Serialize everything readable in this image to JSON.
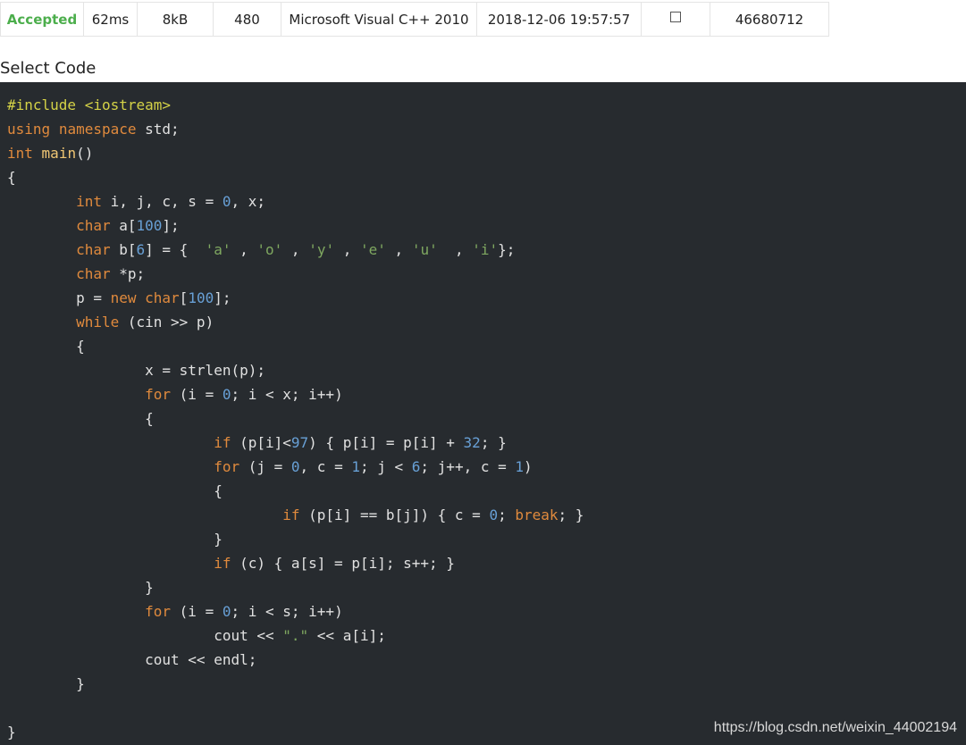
{
  "submission": {
    "verdict": "Accepted",
    "time": "62ms",
    "memory": "8kB",
    "length": "480",
    "language": "Microsoft Visual C++ 2010",
    "submit_time": "2018-12-06 19:57:57",
    "run_id": "46680712"
  },
  "code_section": {
    "label": "Select Code",
    "lines": [
      [
        {
          "t": "pre",
          "v": "#include <iostream>"
        }
      ],
      [
        {
          "t": "kw",
          "v": "using"
        },
        {
          "t": "pl",
          "v": " "
        },
        {
          "t": "kw",
          "v": "namespace"
        },
        {
          "t": "pl",
          "v": " std;"
        }
      ],
      [
        {
          "t": "kw",
          "v": "int"
        },
        {
          "t": "pl",
          "v": " "
        },
        {
          "t": "fn",
          "v": "main"
        },
        {
          "t": "pl",
          "v": "()"
        }
      ],
      [
        {
          "t": "pl",
          "v": "{"
        }
      ],
      [
        {
          "t": "pl",
          "v": "        "
        },
        {
          "t": "kw",
          "v": "int"
        },
        {
          "t": "pl",
          "v": " i, j, c, s = "
        },
        {
          "t": "num",
          "v": "0"
        },
        {
          "t": "pl",
          "v": ", x;"
        }
      ],
      [
        {
          "t": "pl",
          "v": "        "
        },
        {
          "t": "kw",
          "v": "char"
        },
        {
          "t": "pl",
          "v": " a["
        },
        {
          "t": "num",
          "v": "100"
        },
        {
          "t": "pl",
          "v": "];"
        }
      ],
      [
        {
          "t": "pl",
          "v": "        "
        },
        {
          "t": "kw",
          "v": "char"
        },
        {
          "t": "pl",
          "v": " b["
        },
        {
          "t": "num",
          "v": "6"
        },
        {
          "t": "pl",
          "v": "] = {  "
        },
        {
          "t": "str",
          "v": "'a'"
        },
        {
          "t": "pl",
          "v": " , "
        },
        {
          "t": "str",
          "v": "'o'"
        },
        {
          "t": "pl",
          "v": " , "
        },
        {
          "t": "str",
          "v": "'y'"
        },
        {
          "t": "pl",
          "v": " , "
        },
        {
          "t": "str",
          "v": "'e'"
        },
        {
          "t": "pl",
          "v": " , "
        },
        {
          "t": "str",
          "v": "'u'"
        },
        {
          "t": "pl",
          "v": "  , "
        },
        {
          "t": "str",
          "v": "'i'"
        },
        {
          "t": "pl",
          "v": "};"
        }
      ],
      [
        {
          "t": "pl",
          "v": "        "
        },
        {
          "t": "kw",
          "v": "char"
        },
        {
          "t": "pl",
          "v": " *p;"
        }
      ],
      [
        {
          "t": "pl",
          "v": "        p = "
        },
        {
          "t": "kw",
          "v": "new"
        },
        {
          "t": "pl",
          "v": " "
        },
        {
          "t": "kw",
          "v": "char"
        },
        {
          "t": "pl",
          "v": "["
        },
        {
          "t": "num",
          "v": "100"
        },
        {
          "t": "pl",
          "v": "];"
        }
      ],
      [
        {
          "t": "pl",
          "v": "        "
        },
        {
          "t": "kw",
          "v": "while"
        },
        {
          "t": "pl",
          "v": " (cin >> p)"
        }
      ],
      [
        {
          "t": "pl",
          "v": "        {"
        }
      ],
      [
        {
          "t": "pl",
          "v": "                x = strlen(p);"
        }
      ],
      [
        {
          "t": "pl",
          "v": "                "
        },
        {
          "t": "kw",
          "v": "for"
        },
        {
          "t": "pl",
          "v": " (i = "
        },
        {
          "t": "num",
          "v": "0"
        },
        {
          "t": "pl",
          "v": "; i < x; i++)"
        }
      ],
      [
        {
          "t": "pl",
          "v": "                {"
        }
      ],
      [
        {
          "t": "pl",
          "v": "                        "
        },
        {
          "t": "kw",
          "v": "if"
        },
        {
          "t": "pl",
          "v": " (p[i]<"
        },
        {
          "t": "num",
          "v": "97"
        },
        {
          "t": "pl",
          "v": ") { p[i] = p[i] + "
        },
        {
          "t": "num",
          "v": "32"
        },
        {
          "t": "pl",
          "v": "; }"
        }
      ],
      [
        {
          "t": "pl",
          "v": "                        "
        },
        {
          "t": "kw",
          "v": "for"
        },
        {
          "t": "pl",
          "v": " (j = "
        },
        {
          "t": "num",
          "v": "0"
        },
        {
          "t": "pl",
          "v": ", c = "
        },
        {
          "t": "num",
          "v": "1"
        },
        {
          "t": "pl",
          "v": "; j < "
        },
        {
          "t": "num",
          "v": "6"
        },
        {
          "t": "pl",
          "v": "; j++, c = "
        },
        {
          "t": "num",
          "v": "1"
        },
        {
          "t": "pl",
          "v": ")"
        }
      ],
      [
        {
          "t": "pl",
          "v": "                        {"
        }
      ],
      [
        {
          "t": "pl",
          "v": "                                "
        },
        {
          "t": "kw",
          "v": "if"
        },
        {
          "t": "pl",
          "v": " (p[i] == b[j]) { c = "
        },
        {
          "t": "num",
          "v": "0"
        },
        {
          "t": "pl",
          "v": "; "
        },
        {
          "t": "kw",
          "v": "break"
        },
        {
          "t": "pl",
          "v": "; }"
        }
      ],
      [
        {
          "t": "pl",
          "v": "                        }"
        }
      ],
      [
        {
          "t": "pl",
          "v": "                        "
        },
        {
          "t": "kw",
          "v": "if"
        },
        {
          "t": "pl",
          "v": " (c) { a[s] = p[i]; s++; }"
        }
      ],
      [
        {
          "t": "pl",
          "v": "                }"
        }
      ],
      [
        {
          "t": "pl",
          "v": "                "
        },
        {
          "t": "kw",
          "v": "for"
        },
        {
          "t": "pl",
          "v": " (i = "
        },
        {
          "t": "num",
          "v": "0"
        },
        {
          "t": "pl",
          "v": "; i < s; i++)"
        }
      ],
      [
        {
          "t": "pl",
          "v": "                        cout << "
        },
        {
          "t": "str",
          "v": "\".\""
        },
        {
          "t": "pl",
          "v": " << a[i];"
        }
      ],
      [
        {
          "t": "pl",
          "v": "                cout << endl;"
        }
      ],
      [
        {
          "t": "pl",
          "v": "        }"
        }
      ],
      [
        {
          "t": "pl",
          "v": ""
        }
      ],
      [
        {
          "t": "pl",
          "v": "}"
        }
      ]
    ]
  },
  "watermark": "https://blog.csdn.net/weixin_44002194",
  "colors": {
    "verdict_green": "#4cae4c",
    "code_background": "#272b2f",
    "keyword": "#e08a3d",
    "preprocessor": "#d4d247",
    "number": "#68a0d6",
    "string": "#7fa860",
    "function": "#f0c674"
  }
}
